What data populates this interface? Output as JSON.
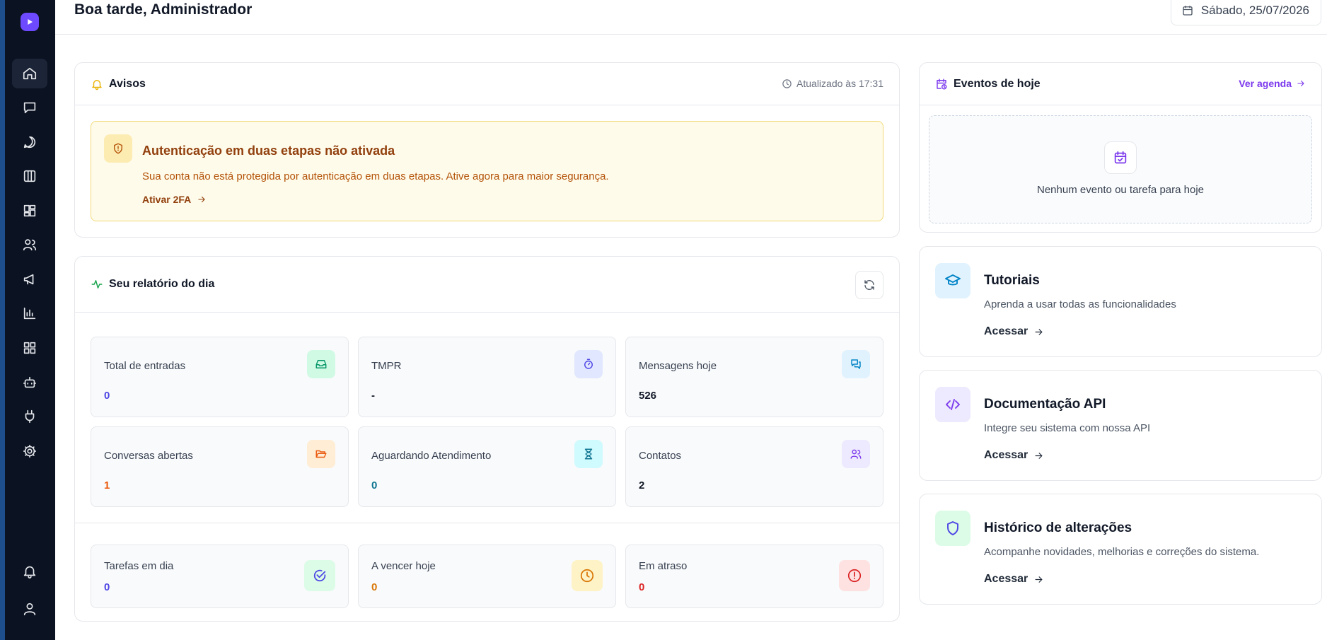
{
  "header": {
    "greeting": "Boa tarde, Administrador",
    "date": "Sábado, 25/07/2026"
  },
  "sidebar": {
    "items": [
      {
        "name": "home-icon",
        "active": true
      },
      {
        "name": "inbox-message-icon"
      },
      {
        "name": "chat-bubble-icon"
      },
      {
        "name": "kanban-board-icon"
      },
      {
        "name": "dashboard-grid-icon"
      },
      {
        "name": "users-icon"
      },
      {
        "name": "megaphone-icon"
      },
      {
        "name": "bar-chart-icon"
      },
      {
        "name": "apps-grid-icon"
      },
      {
        "name": "bot-icon"
      },
      {
        "name": "plug-icon"
      },
      {
        "name": "gear-icon"
      }
    ],
    "bottom": [
      {
        "name": "bell-icon"
      },
      {
        "name": "user-icon"
      }
    ]
  },
  "avisos": {
    "title": "Avisos",
    "updated": "Atualizado às 17:31",
    "alert": {
      "title": "Autenticação em duas etapas não ativada",
      "text": "Sua conta não está protegida por autenticação em duas etapas. Ative agora para maior segurança.",
      "link": "Ativar 2FA"
    }
  },
  "report": {
    "title": "Seu relatório do dia",
    "stats": [
      {
        "label": "Total de entradas",
        "value": "0"
      },
      {
        "label": "TMPR",
        "value": "-"
      },
      {
        "label": "Mensagens hoje",
        "value": "526"
      },
      {
        "label": "Conversas abertas",
        "value": "1"
      },
      {
        "label": "Aguardando Atendimento",
        "value": "0"
      },
      {
        "label": "Contatos",
        "value": "2"
      }
    ],
    "tasks": [
      {
        "label": "Tarefas em dia",
        "value": "0"
      },
      {
        "label": "A vencer hoje",
        "value": "0"
      },
      {
        "label": "Em atraso",
        "value": "0"
      }
    ]
  },
  "eventos": {
    "title": "Eventos de hoje",
    "link": "Ver agenda",
    "empty": "Nenhum evento ou tarefa para hoje"
  },
  "links": [
    {
      "title": "Tutoriais",
      "desc": "Aprenda a usar todas as funcionalidades",
      "link": "Acessar"
    },
    {
      "title": "Documentação API",
      "desc": "Integre seu sistema com nossa API",
      "link": "Acessar"
    },
    {
      "title": "Histórico de alterações",
      "desc": "Acompanhe novidades, melhorias e correções do sistema.",
      "link": "Acessar"
    }
  ],
  "colors": {
    "sidebar_bg": "#0b1222",
    "accent_purple": "#7c3aed",
    "warning_bg": "#fefbea",
    "warning_text": "#92400e",
    "value_indigo": "#4f46e5",
    "value_orange": "#ea580c",
    "value_teal": "#0e7490",
    "value_amber": "#d97706",
    "value_red": "#dc2626"
  }
}
